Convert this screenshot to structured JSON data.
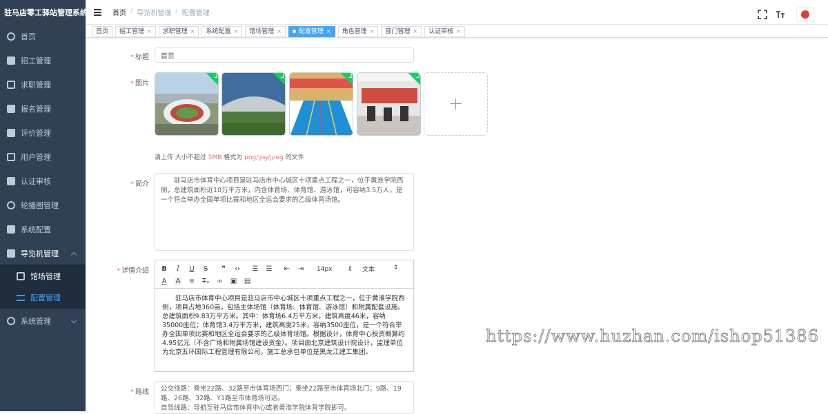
{
  "app_title": "驻马店零工驿站管理系统",
  "sidebar": {
    "items": [
      {
        "label": "首页",
        "icon": "dashboard-icon"
      },
      {
        "label": "招工管理",
        "icon": "document-icon"
      },
      {
        "label": "求职管理",
        "icon": "resume-icon"
      },
      {
        "label": "报名管理",
        "icon": "form-icon"
      },
      {
        "label": "评价管理",
        "icon": "message-icon"
      },
      {
        "label": "用户管理",
        "icon": "user-icon"
      },
      {
        "label": "认证审核",
        "icon": "lock-icon"
      },
      {
        "label": "轮播图管理",
        "icon": "carousel-icon"
      },
      {
        "label": "系统配置",
        "icon": "config-icon"
      },
      {
        "label": "导览机管理",
        "icon": "guide-icon",
        "expanded": true
      },
      {
        "label": "系统管理",
        "icon": "gear-icon"
      }
    ],
    "submenu": [
      {
        "label": "馆场管理",
        "icon": "grid-icon"
      },
      {
        "label": "配置管理",
        "icon": "sliders-icon",
        "active": true
      }
    ]
  },
  "header": {
    "breadcrumb": [
      "首页",
      "导览机管理",
      "配置管理"
    ],
    "tools": [
      "fullscreen-icon",
      "font-size-icon"
    ]
  },
  "tags": [
    {
      "label": "首页",
      "closable": false
    },
    {
      "label": "招工管理",
      "closable": true
    },
    {
      "label": "求职管理",
      "closable": true
    },
    {
      "label": "系统配置",
      "closable": true
    },
    {
      "label": "馆场管理",
      "closable": true
    },
    {
      "label": "配置管理",
      "closable": true,
      "active": true
    },
    {
      "label": "角色管理",
      "closable": true
    },
    {
      "label": "部门管理",
      "closable": true
    },
    {
      "label": "认证审核",
      "closable": true
    }
  ],
  "form": {
    "title_label": "标题",
    "title_value": "首页",
    "image_label": "图片",
    "upload_tip_prefix": "请上传 大小不超过 ",
    "upload_tip_size": "5MB",
    "upload_tip_mid": " 格式为 ",
    "upload_tip_format": "png/jpg/jpeg",
    "upload_tip_suffix": " 的文件",
    "intro_label": "简介",
    "intro_value": "驻马店市体育中心项目是驻马店市中心城区十项重点工程之一，位于黄淮学院西侧，总建筑面积近10万平方米，内含体育场、体育馆、游泳馆，可容纳3.5万人，是一个符合举办全国单项比赛和地区全运会要求的乙级体育场馆。",
    "detail_label": "详情介绍",
    "font_size_select": "14px",
    "paragraph_select": "文本",
    "detail_value": "驻马店市体育中心项目是驻马店市中心城区十项重点工程之一，位于黄淮学院西侧，项目占地360亩，包括主体场馆（体育场、体育馆、游泳馆）和附属配套设施。总建筑面积9.83万平方米。其中：体育场6.4万平方米，建筑高度46米，容纳35000座位；体育馆3.4万平方米，建筑高度25米，容纳3500座位，是一个符合举办全国单项比赛和地区全运会要求的乙级体育场馆。根据设计，体育中心投资概算约4.95亿元（不含广场和附属场馆建设资金）。项目由北京建筑设计院设计，监理单位为北京五环国际工程管理有限公司，施工总承包单位是黑龙江建工集团。",
    "route_label": "路线",
    "route_line1": "公交线路：乘坐22路、32路至市体育场西门；乘坐22路至市体育场北门；9路、19路、26路、32路、Y1路至市体育场可达。",
    "route_line2": "自驾线路：导航至驻马店市体育中心或者黄淮学院体育学院即可。"
  },
  "watermark": "https://www.huzhan.com/ishop51386",
  "colors": {
    "sidebar_bg": "#304156",
    "submenu_bg": "#1f2d3d",
    "accent": "#409eff",
    "active_tag": "#42a5f5",
    "required": "#f56c6c",
    "upload_success": "#13ce66"
  }
}
